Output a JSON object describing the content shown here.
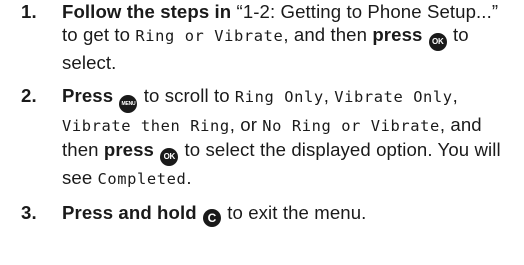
{
  "steps": [
    {
      "number": "1.",
      "lead": "Follow the steps in",
      "ref": " “1-2: Getting to Phone Setup...” to get to ",
      "lcd1": "Ring or Vibrate",
      "mid": ", and then ",
      "action": "press",
      "key": "OK",
      "tail": " to select."
    },
    {
      "number": "2.",
      "lead": "Press",
      "key": "MENU",
      "text1": " to scroll to ",
      "opt1": "Ring Only",
      "sep1": ", ",
      "opt2": "Vibrate Only",
      "sep2": ", ",
      "opt3": "Vibrate then Ring",
      "sep3": ", or ",
      "opt4": "No Ring or Vibrate",
      "text2": ", and then ",
      "action": "press",
      "key2": "OK",
      "text3": " to select the displayed option. You will see ",
      "lcd_result": "Completed",
      "end": "."
    },
    {
      "number": "3.",
      "lead": "Press and hold",
      "key": "C",
      "tail": " to exit the menu."
    }
  ]
}
